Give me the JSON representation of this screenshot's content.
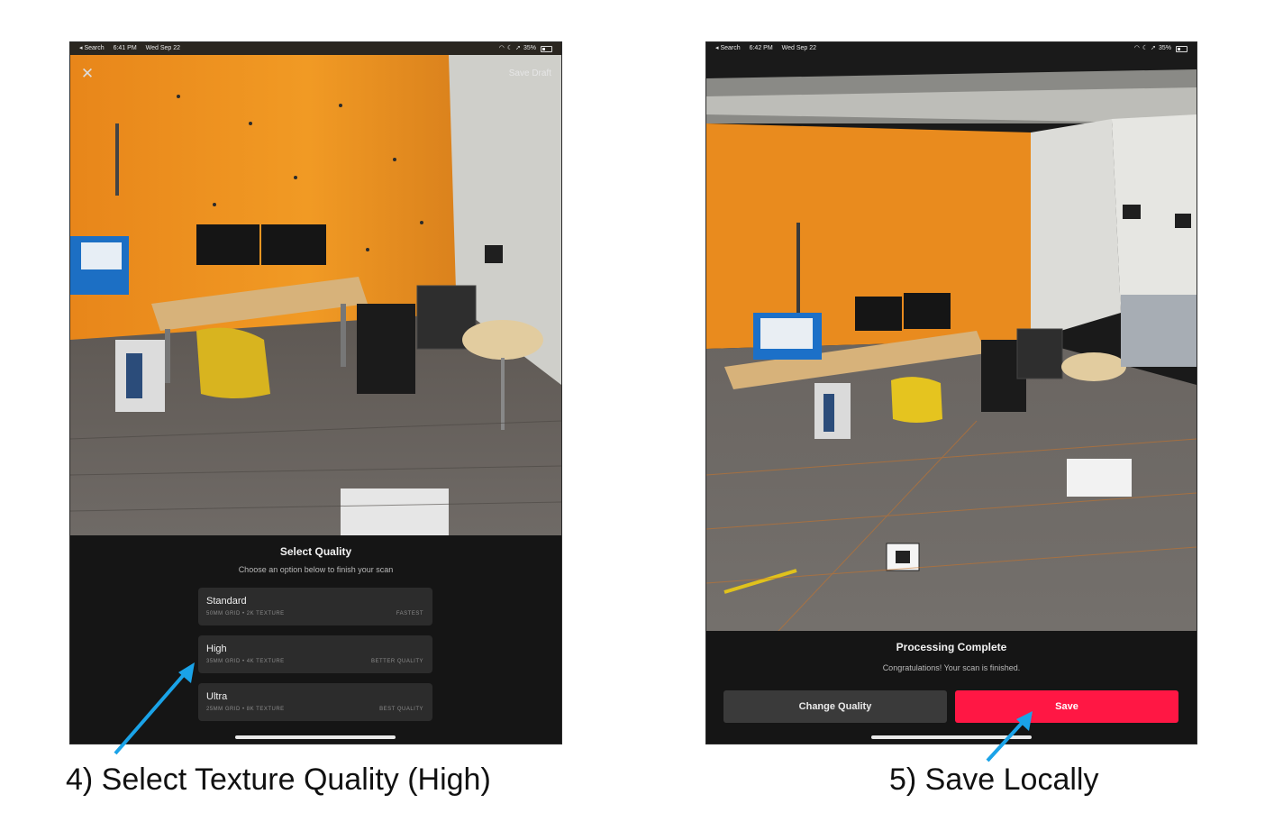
{
  "left_screen": {
    "status": {
      "back_label": "◂ Search",
      "time": "6:41 PM",
      "date": "Wed Sep 22",
      "battery": "35%"
    },
    "save_draft_label": "Save Draft",
    "panel": {
      "title": "Select Quality",
      "subtitle": "Choose an option below to finish your scan",
      "options": [
        {
          "name": "Standard",
          "spec": "50MM GRID  •  2K TEXTURE",
          "tag": "FASTEST"
        },
        {
          "name": "High",
          "spec": "35MM GRID  •  4K TEXTURE",
          "tag": "BETTER QUALITY"
        },
        {
          "name": "Ultra",
          "spec": "25MM GRID  •  8K TEXTURE",
          "tag": "BEST QUALITY"
        }
      ]
    }
  },
  "right_screen": {
    "status": {
      "back_label": "◂ Search",
      "time": "6:42 PM",
      "date": "Wed Sep 22",
      "battery": "35%"
    },
    "panel": {
      "title": "Processing Complete",
      "subtitle": "Congratulations! Your scan is finished.",
      "change_quality_label": "Change Quality",
      "save_label": "Save"
    }
  },
  "captions": {
    "left": "4) Select Texture Quality (High)",
    "right": "5) Save Locally"
  },
  "colors": {
    "accent_red": "#ff1744",
    "arrow_blue": "#1aa3e8",
    "panel_bg": "#151515",
    "option_bg": "#2c2c2c"
  }
}
